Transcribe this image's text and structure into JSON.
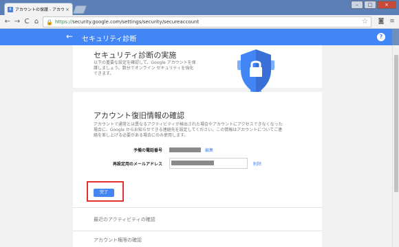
{
  "browser": {
    "tab_title": "アカウントの保護 - アカウント",
    "tab_favicon": "8",
    "tab_close": "×",
    "url_scheme": "https://",
    "url_rest": "security.google.com/settings/security/secureaccount",
    "window_buttons": {
      "minimize": "–",
      "maximize": "□",
      "close": "×"
    },
    "nav": {
      "back": "←",
      "forward": "→",
      "reload": "C",
      "home": "⌂"
    },
    "star_icon": "☆",
    "toolbar_icons": {
      "camera": "◙",
      "menu": "≡"
    }
  },
  "appbar": {
    "title": "セキュリティ診断",
    "back_icon": "←",
    "help_icon": "?",
    "color": "#4285f4"
  },
  "section1": {
    "title": "セキュリティ診断の実施",
    "description_line1": "以下の重要な設定を確認して、Google アカウントを保",
    "description_line2": "護しましょう。数分でオンライン セキュリティを強化",
    "description_line3": "できます。"
  },
  "section2": {
    "title": "アカウント復旧情報の確認",
    "description_line1": "アカウントで通常とは異なるアクティビティが検出された場合やアカウントにアクセスできなくなった",
    "description_line2": "場合に、Google からお知らせできる連絡先を設定してください。この情報はアカウントについてご連",
    "description_line3": "絡を差し上げる必要がある場合にのみ使用します。",
    "phone_label": "予備の電話番号",
    "phone_action": "編集",
    "email_label": "再設定用のメールアドレス",
    "email_action": "削除",
    "done_button": "完了"
  },
  "sub_items": {
    "recent_activity": "最近のアクティビティの確認",
    "account_permissions": "アカウント権限の確認"
  }
}
